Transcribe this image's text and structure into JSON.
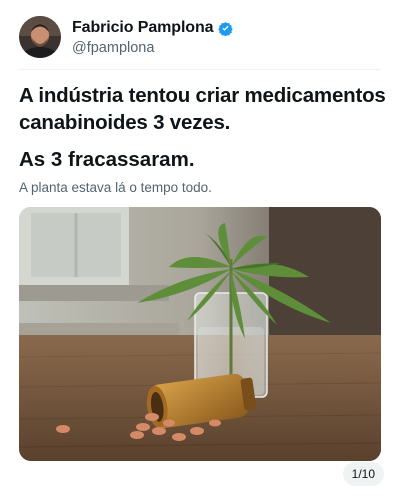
{
  "author": {
    "name": "Fabricio Pamplona",
    "handle": "@fpamplona",
    "verified": true,
    "verified_color": "#1d9bf0"
  },
  "post": {
    "headline": "A indústria tentou criar medicamentos canabinoides 3 vezes.",
    "headline2": "As 3 fracassaram.",
    "subline": "A planta estava lá o tempo todo."
  },
  "media": {
    "counter": "1/10",
    "subject": "cannabis-plant-in-glass-with-spilled-pill-bottle"
  }
}
